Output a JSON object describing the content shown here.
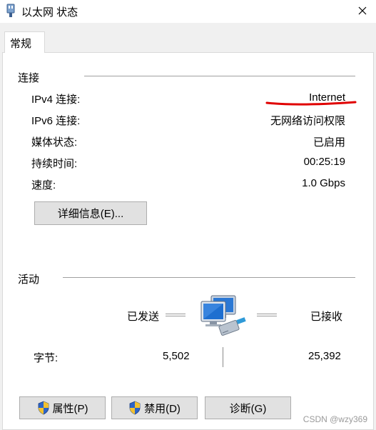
{
  "window": {
    "title": "以太网 状态",
    "close_icon": "close-icon",
    "title_icon": "network-adapter-icon"
  },
  "tabs": [
    {
      "label": "常规",
      "selected": true
    }
  ],
  "connection": {
    "group_label": "连接",
    "rows": [
      {
        "label": "IPv4 连接:",
        "value": "Internet"
      },
      {
        "label": "IPv6 连接:",
        "value": "无网络访问权限"
      },
      {
        "label": "媒体状态:",
        "value": "已启用"
      },
      {
        "label": "持续时间:",
        "value": "00:25:19"
      },
      {
        "label": "速度:",
        "value": "1.0 Gbps"
      }
    ],
    "details_button": "详细信息(E)...",
    "annotation_color": "#e00000"
  },
  "activity": {
    "group_label": "活动",
    "sent_label": "已发送",
    "received_label": "已接收",
    "bytes_label": "字节:",
    "bytes_sent": "5,502",
    "bytes_received": "25,392",
    "icon": "network-computers-icon"
  },
  "buttons": {
    "properties": "属性(P)",
    "disable": "禁用(D)",
    "diagnose": "诊断(G)",
    "shield_icon": "uac-shield-icon"
  },
  "watermark": "CSDN @wzy369"
}
